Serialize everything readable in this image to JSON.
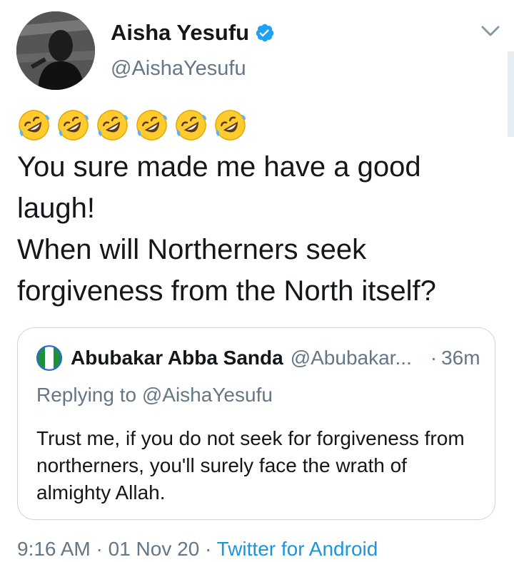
{
  "tweet": {
    "author": {
      "display_name": "Aisha Yesufu",
      "handle": "@AishaYesufu",
      "verified": true,
      "avatar_icon": "profile-photo"
    },
    "emoji": {
      "icon": "rolling-on-the-floor-laughing-emoji",
      "count": 6
    },
    "text": "You sure made me have a good laugh!\nWhen will Northerners seek forgiveness from the North itself?",
    "timestamp": {
      "time": "9:16 AM",
      "separator": "·",
      "date": "01 Nov 20",
      "source": "Twitter for Android"
    }
  },
  "quoted_tweet": {
    "display_name": "Abubakar Abba Sanda",
    "handle": "@Abubakar...",
    "dot": "·",
    "time": "36m",
    "replying_to": "Replying to @AishaYesufu",
    "text": "Trust me, if you do not seek for forgiveness from northerners, you'll surely face the wrath of almighty Allah.",
    "avatar_icon": "nigeria-flag-icon"
  },
  "colors": {
    "text_primary": "#14171a",
    "text_secondary": "#657786",
    "link_blue": "#1b95e0",
    "border": "#ccd6dd",
    "verified_blue": "#1da1f2"
  }
}
